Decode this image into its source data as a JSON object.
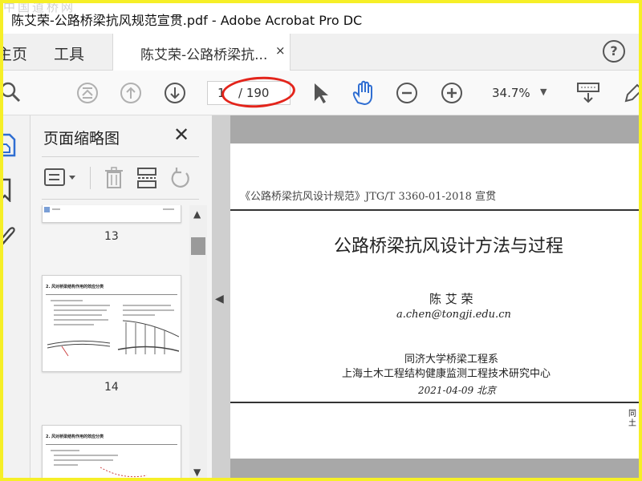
{
  "window": {
    "title": "陈艾荣-公路桥梁抗风规范宣贯.pdf - Adobe Acrobat Pro DC",
    "watermark": "中国道桥网"
  },
  "menu": {
    "home": "主页",
    "tools": "工具",
    "doc_tab": "陈艾荣-公路桥梁抗...",
    "doc_tab_close": "×",
    "help": "?"
  },
  "toolbar": {
    "current_page": "1",
    "total_pages": "/ 190",
    "zoom": "34.7%",
    "zoom_caret": "▼"
  },
  "panel": {
    "title": "页面缩略图",
    "close": "✕",
    "thumbnails": [
      {
        "number": "13"
      },
      {
        "number": "14",
        "heading": "2. 风对桥梁结构作用的效应分类"
      },
      {
        "heading": "2. 风对桥梁结构作用的效应分类"
      }
    ]
  },
  "document": {
    "header": "《公路桥梁抗风设计规范》JTG/T 3360-01-2018 宣贯",
    "title": "公路桥梁抗风设计方法与过程",
    "author": "陈 艾 荣",
    "email": "a.chen@tongji.edu.cn",
    "org1": "同济大学桥梁工程系",
    "org2": "上海土木工程结构健康监测工程技术研究中心",
    "date": "2021-04-09 北京",
    "edge1": "同",
    "edge2": "土"
  },
  "colors": {
    "frame": "#f6ef27",
    "annotation_oval": "#e3241b",
    "hand_tool": "#2f6ed2"
  },
  "icons": [
    "search-icon",
    "first-page-icon",
    "prev-page-icon",
    "next-page-icon",
    "select-arrow-icon",
    "hand-icon",
    "zoom-out-icon",
    "zoom-in-icon",
    "keyboard-icon",
    "pen-icon",
    "options-icon",
    "delete-icon",
    "insert-icon",
    "rotate-icon",
    "pages-icon",
    "bookmark-icon",
    "attachment-icon"
  ]
}
